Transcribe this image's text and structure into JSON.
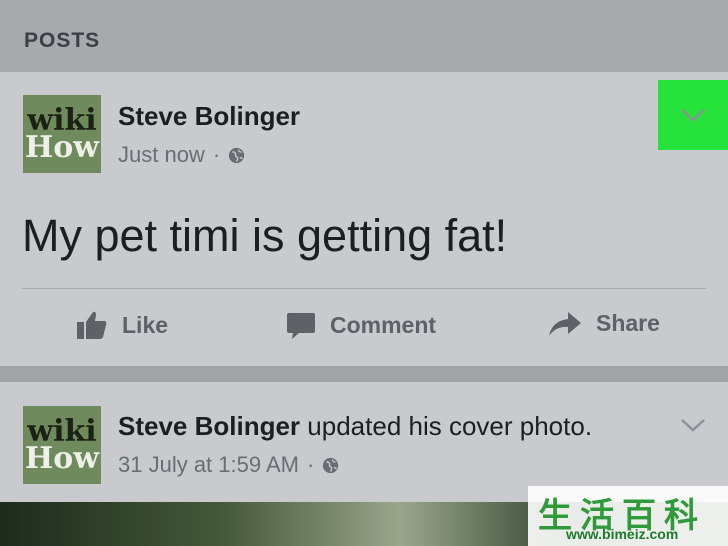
{
  "section": {
    "title": "POSTS"
  },
  "posts": [
    {
      "author": "Steve Bolinger",
      "action_text": "",
      "time": "Just now",
      "separator": "·",
      "avatar_lines": [
        "wiki",
        "How"
      ],
      "content": "My pet timi is getting fat!",
      "menu_highlighted": true
    },
    {
      "author": "Steve Bolinger",
      "action_text": "updated his cover photo.",
      "time": "31 July at 1:59 AM",
      "separator": "·",
      "avatar_lines": [
        "wiki",
        "How"
      ],
      "menu_highlighted": false
    }
  ],
  "actions": {
    "like": "Like",
    "comment": "Comment",
    "share": "Share"
  },
  "watermark": {
    "text": "生活百科",
    "url": "www.bimeiz.com"
  },
  "colors": {
    "highlight": "#26e33b",
    "card": "#c9cacd",
    "header_bg": "#a7a9ac"
  },
  "icons": [
    "chevron-down-icon",
    "globe-icon",
    "thumbs-up-icon",
    "comment-icon",
    "share-arrow-icon"
  ]
}
